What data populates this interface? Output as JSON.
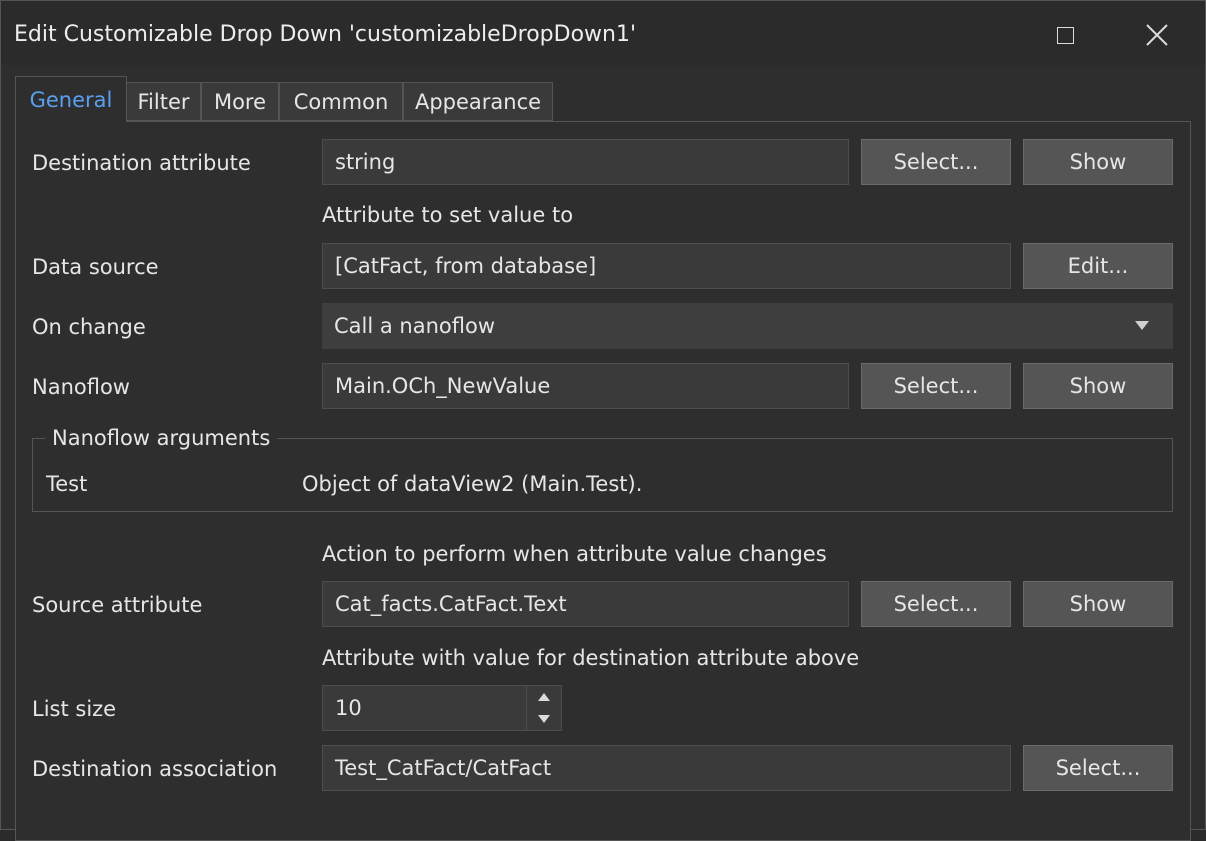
{
  "window": {
    "title": "Edit Customizable Drop Down 'customizableDropDown1'"
  },
  "tabs": [
    {
      "label": "General"
    },
    {
      "label": "Filter"
    },
    {
      "label": "More"
    },
    {
      "label": "Common"
    },
    {
      "label": "Appearance"
    }
  ],
  "general": {
    "destination_attribute": {
      "label": "Destination attribute",
      "value": "string",
      "select": "Select...",
      "show": "Show",
      "hint": "Attribute to set value to"
    },
    "data_source": {
      "label": "Data source",
      "value": "[CatFact, from database]",
      "edit": "Edit..."
    },
    "on_change": {
      "label": "On change",
      "value": "Call a nanoflow"
    },
    "nanoflow": {
      "label": "Nanoflow",
      "value": "Main.OCh_NewValue",
      "select": "Select...",
      "show": "Show"
    },
    "nanoflow_arguments": {
      "legend": "Nanoflow arguments",
      "name": "Test",
      "value": "Object of dataView2 (Main.Test).",
      "hint": "Action to perform when attribute value changes"
    },
    "source_attribute": {
      "label": "Source attribute",
      "value": "Cat_facts.CatFact.Text",
      "select": "Select...",
      "show": "Show",
      "hint": "Attribute with value for destination attribute above"
    },
    "list_size": {
      "label": "List size",
      "value": "10"
    },
    "destination_association": {
      "label": "Destination association",
      "value": "Test_CatFact/CatFact",
      "select": "Select..."
    }
  },
  "colors": {
    "accent": "#5aa0f0",
    "background": "#2e2e2e"
  }
}
